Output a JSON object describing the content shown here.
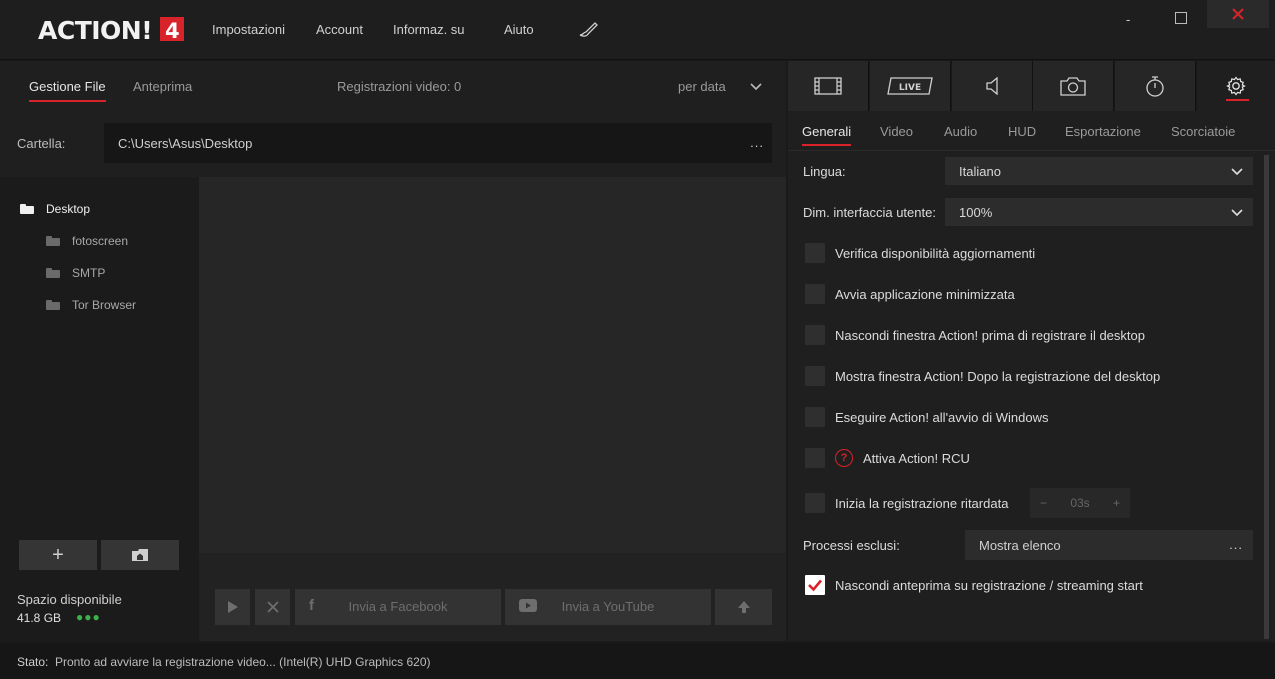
{
  "app": {
    "logo_text": "ACTION! 4",
    "accent": "#d8232a"
  },
  "menu": {
    "settings": "Impostazioni",
    "account": "Account",
    "info": "Informaz. su",
    "help": "Aiuto"
  },
  "window": {
    "minimize": "-"
  },
  "files": {
    "tab_files": "Gestione File",
    "tab_preview": "Anteprima",
    "recordings": "Registrazioni video: 0",
    "sort": "per data",
    "folder_label": "Cartella:",
    "folder_path": "C:\\Users\\Asus\\Desktop",
    "browse": "...",
    "tree": [
      {
        "label": "Desktop"
      },
      {
        "label": "fotoscreen"
      },
      {
        "label": "SMTP"
      },
      {
        "label": "Tor Browser"
      }
    ],
    "add": "+",
    "space_label": "Spazio disponibile",
    "space_value": "41.8 GB",
    "space_dots": "●●●",
    "facebook": "Invia a Facebook",
    "youtube": "Invia a YouTube",
    "facebook_icon": "f"
  },
  "settings": {
    "live_label": "LIVE",
    "tabs": [
      "Generali",
      "Video",
      "Audio",
      "HUD",
      "Esportazione",
      "Scorciatoie"
    ],
    "language_label": "Lingua:",
    "language_value": "Italiano",
    "ui_size_label": "Dim. interfaccia utente:",
    "ui_size_value": "100%",
    "options": [
      {
        "label": "Verifica disponibilità aggiornamenti",
        "checked": false
      },
      {
        "label": "Avvia applicazione minimizzata",
        "checked": false
      },
      {
        "label": "Nascondi finestra Action! prima di registrare il desktop",
        "checked": false
      },
      {
        "label": "Mostra finestra Action! Dopo la registrazione del desktop",
        "checked": false
      },
      {
        "label": "Eseguire Action! all'avvio di Windows",
        "checked": false
      },
      {
        "label": "Attiva Action! RCU",
        "checked": false
      },
      {
        "label": "Inizia la registrazione ritardata",
        "checked": false
      }
    ],
    "help_mark": "?",
    "delay_value": "03s",
    "delay_minus": "−",
    "delay_plus": "+",
    "excluded_label": "Processi esclusi:",
    "excluded_button": "Mostra elenco",
    "excluded_dots": "...",
    "hide_preview_label": "Nascondi anteprima su registrazione / streaming start",
    "hide_preview_checked": true
  },
  "status": {
    "label": "Stato:",
    "text": "Pronto ad avviare la registrazione video...  (Intel(R) UHD Graphics 620)"
  }
}
